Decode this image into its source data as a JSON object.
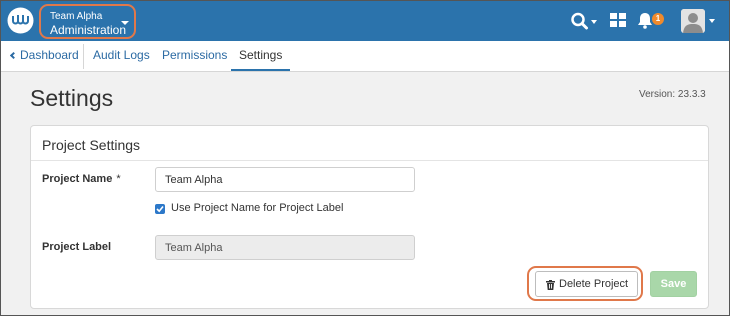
{
  "header": {
    "project_name": "Team Alpha",
    "section": "Administration",
    "notification_count": "1",
    "colors": {
      "bar": "#2b73ac",
      "highlight": "#e0784a",
      "badge": "#f08a2c"
    },
    "icons": [
      "logo-icon",
      "search-icon",
      "apps-grid-icon",
      "bell-icon",
      "user-avatar"
    ]
  },
  "tabs": {
    "dashboard": "Dashboard",
    "audit_logs": "Audit Logs",
    "permissions": "Permissions",
    "settings": "Settings",
    "active": "Settings"
  },
  "page": {
    "title": "Settings",
    "version": "Version: 23.3.3"
  },
  "project_settings": {
    "title": "Project Settings",
    "name_label": "Project Name",
    "required_marker": "*",
    "name_value": "Team Alpha",
    "use_name_checkbox_label": "Use Project Name for Project Label",
    "use_name_checked": true,
    "label_label": "Project Label",
    "label_value": "Team Alpha",
    "delete_button": "Delete Project",
    "save_button": "Save"
  }
}
